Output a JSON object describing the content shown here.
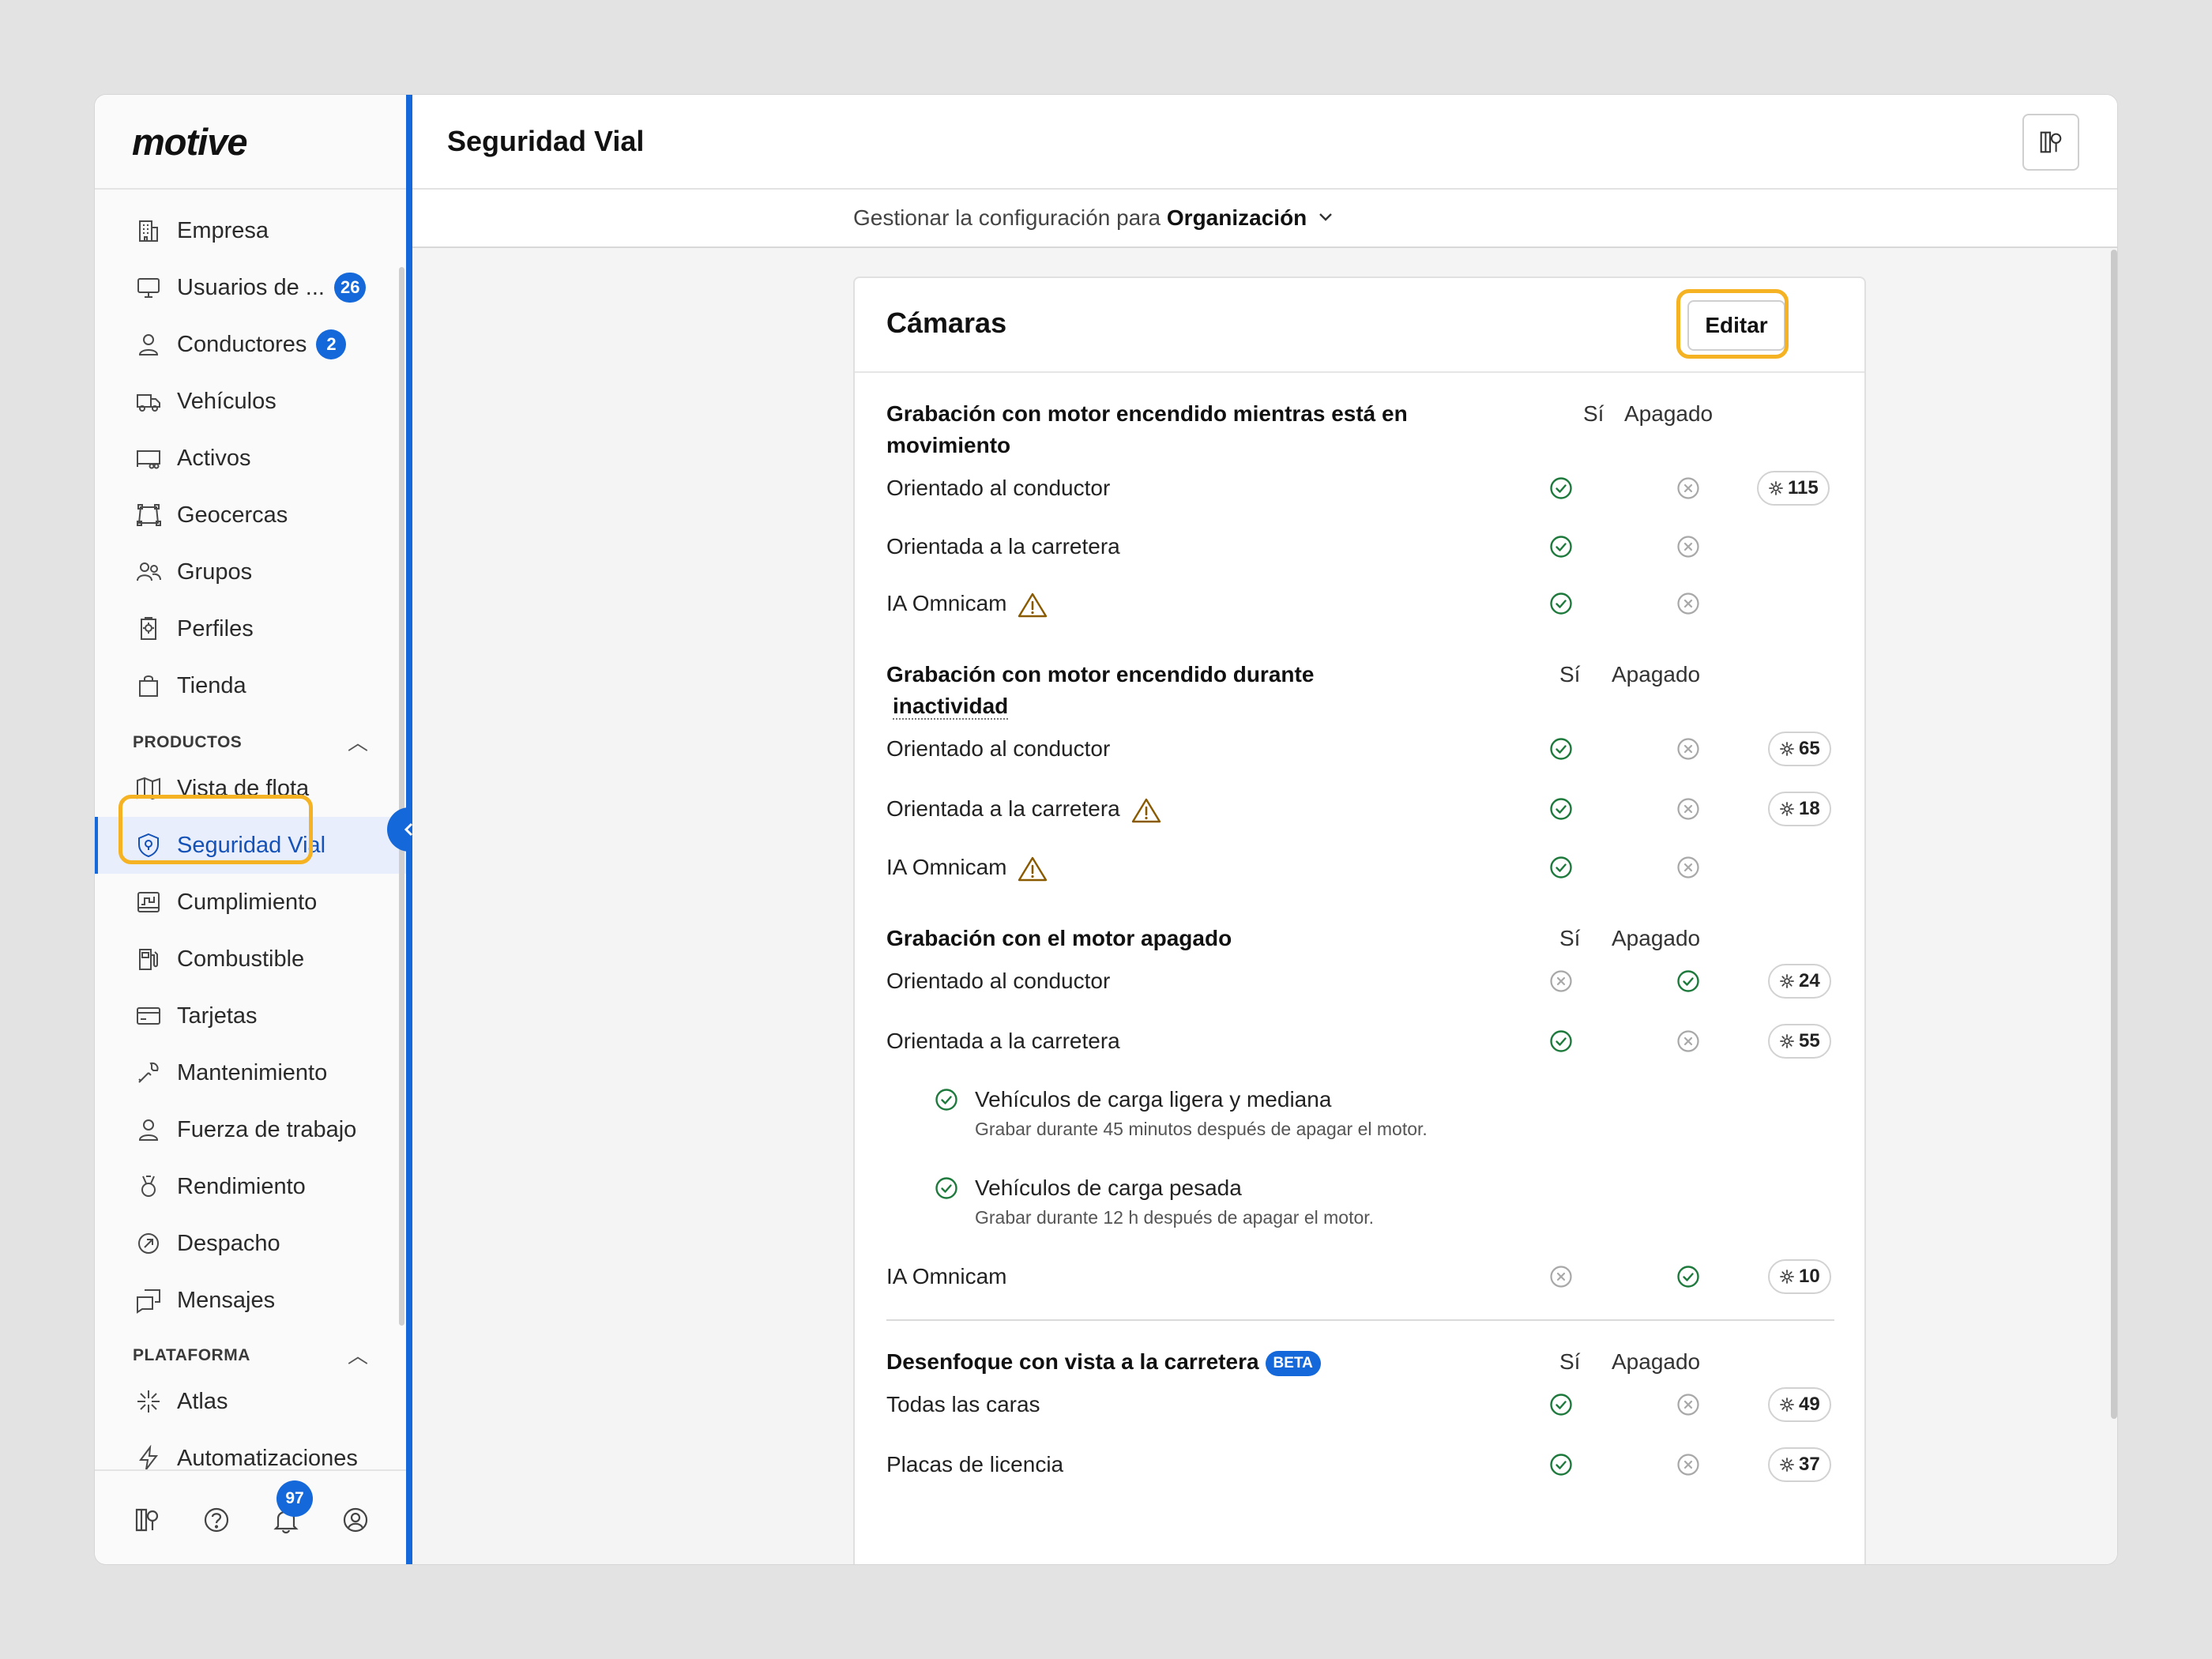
{
  "sidebar": {
    "logo": "motive",
    "items": [
      {
        "label": "Empresa",
        "icon": "building-icon"
      },
      {
        "label": "Usuarios de ...",
        "icon": "monitor-icon",
        "badge": "26"
      },
      {
        "label": "Conductores",
        "icon": "person-icon",
        "badge": "2"
      },
      {
        "label": "Vehículos",
        "icon": "truck-icon"
      },
      {
        "label": "Activos",
        "icon": "trailer-icon"
      },
      {
        "label": "Geocercas",
        "icon": "geofence-icon"
      },
      {
        "label": "Grupos",
        "icon": "groups-icon"
      },
      {
        "label": "Perfiles",
        "icon": "profiles-icon"
      },
      {
        "label": "Tienda",
        "icon": "bag-icon"
      }
    ],
    "products_header": "PRODUCTOS",
    "products": [
      {
        "label": "Vista de flota",
        "icon": "map-icon"
      },
      {
        "label": "Seguridad Vial",
        "icon": "shield-icon",
        "active": true
      },
      {
        "label": "Cumplimiento",
        "icon": "log-icon"
      },
      {
        "label": "Combustible",
        "icon": "fuel-icon"
      },
      {
        "label": "Tarjetas",
        "icon": "card-icon"
      },
      {
        "label": "Mantenimiento",
        "icon": "wrench-icon"
      },
      {
        "label": "Fuerza de trabajo",
        "icon": "worker-icon"
      },
      {
        "label": "Rendimiento",
        "icon": "medal-icon"
      },
      {
        "label": "Despacho",
        "icon": "dispatch-icon"
      },
      {
        "label": "Mensajes",
        "icon": "messages-icon"
      }
    ],
    "platform_header": "PLATAFORMA",
    "platform": [
      {
        "label": "Atlas",
        "icon": "sparkle-icon"
      },
      {
        "label": "Automatizaciones",
        "icon": "bolt-icon"
      }
    ],
    "footer": {
      "notifications_badge": "97"
    }
  },
  "header": {
    "title": "Seguridad Vial",
    "scope_prefix": "Gestionar la configuración para",
    "scope_value": "Organización"
  },
  "card": {
    "title": "Cámaras",
    "edit_label": "Editar",
    "col_yes": "Sí",
    "col_off": "Apagado",
    "sections": [
      {
        "title_line1": "Grabación con motor encendido mientras está en",
        "title_line2": "movimiento",
        "rows": [
          {
            "label": "Orientado al conductor",
            "yes": true,
            "off": false,
            "count": "115"
          },
          {
            "label": "Orientada a la carretera",
            "yes": true,
            "off": false,
            "count": ""
          },
          {
            "label": "IA Omnicam",
            "yes": true,
            "off": false,
            "count": "",
            "warning": true
          }
        ]
      },
      {
        "title_line1": "Grabación con motor encendido durante",
        "title_line2": "inactividad",
        "rows": [
          {
            "label": "Orientado al conductor",
            "yes": true,
            "off": false,
            "count": "65"
          },
          {
            "label": "Orientada a la carretera",
            "yes": true,
            "off": false,
            "count": "18",
            "warning": true
          },
          {
            "label": "IA Omnicam",
            "yes": true,
            "off": false,
            "count": "",
            "warning": true
          }
        ]
      },
      {
        "title_line1": "Grabación con el motor apagado",
        "rows": [
          {
            "label": "Orientado al conductor",
            "yes": false,
            "off": true,
            "count": "24"
          },
          {
            "label": "Orientada a la carretera",
            "yes": true,
            "off": false,
            "count": "55"
          },
          {
            "label": "IA Omnicam",
            "yes": false,
            "off": true,
            "count": "10"
          }
        ],
        "subitems": [
          {
            "label": "Vehículos de carga ligera y mediana",
            "note": "Grabar durante 45 minutos después de apagar el motor."
          },
          {
            "label": "Vehículos de carga pesada",
            "note": "Grabar durante 12 h después de apagar el motor."
          }
        ]
      },
      {
        "title_line1": "Desenfoque con vista a la carretera",
        "badge": "BETA",
        "rows": [
          {
            "label": "Todas las caras",
            "yes": true,
            "off": false,
            "count": "49"
          },
          {
            "label": "Placas de licencia",
            "yes": true,
            "off": false,
            "count": "37"
          }
        ]
      }
    ]
  },
  "colors": {
    "accent": "#1468d9",
    "highlight": "#f5b323",
    "check": "#1e7a3c",
    "warning": "#8a5a00"
  }
}
